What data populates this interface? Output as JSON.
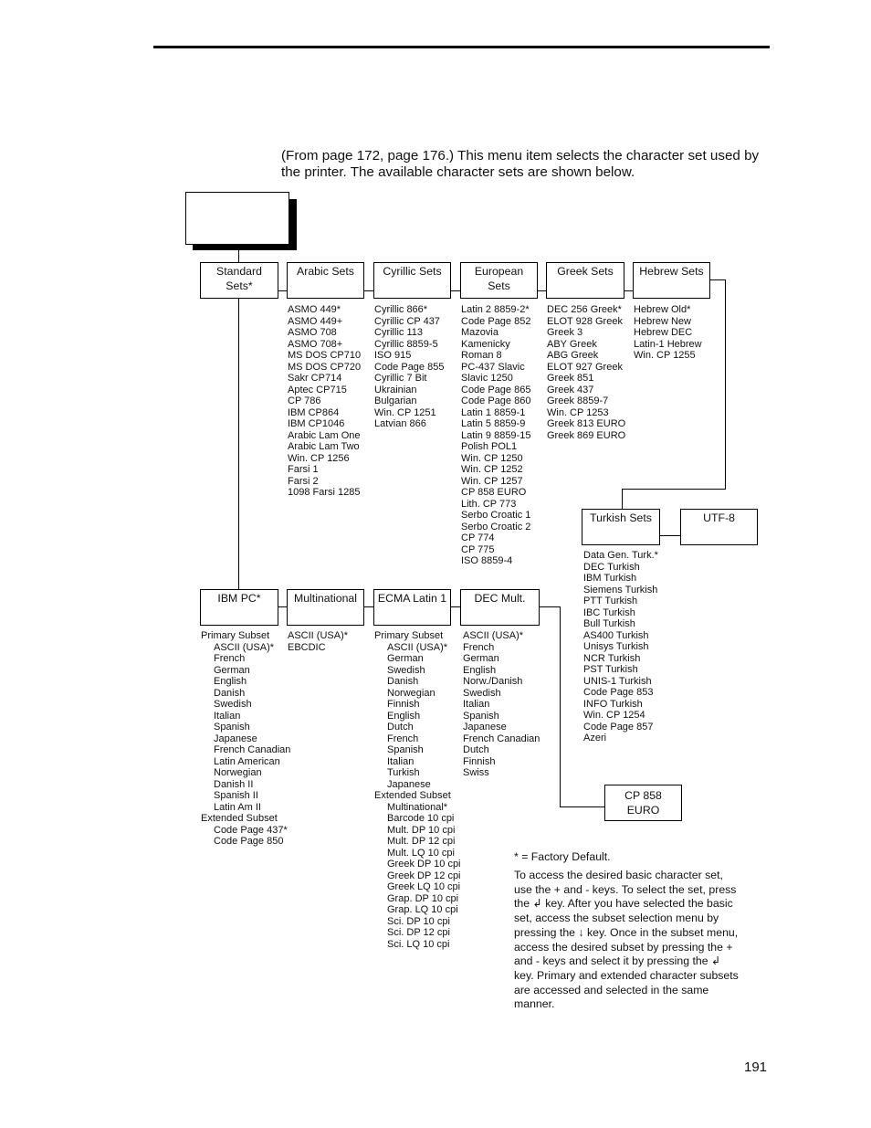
{
  "intro_text": "(From page 172, page 176.) This menu item selects the character set used by the printer. The available character sets are shown below.",
  "top_box_label": "",
  "row1": [
    {
      "label": "Standard Sets*",
      "items": []
    },
    {
      "label": "Arabic Sets",
      "items": [
        "ASMO 449*",
        "ASMO 449+",
        "ASMO 708",
        "ASMO 708+",
        "MS DOS CP710",
        "MS DOS CP720",
        "Sakr CP714",
        "Aptec CP715",
        "CP 786",
        "IBM CP864",
        "IBM CP1046",
        "Arabic Lam One",
        "Arabic Lam Two",
        "Win. CP 1256",
        "Farsi 1",
        "Farsi 2",
        "1098 Farsi 1285"
      ]
    },
    {
      "label": "Cyrillic Sets",
      "items": [
        "Cyrillic 866*",
        "Cyrillic CP 437",
        "Cyrillic 113",
        "Cyrillic 8859-5",
        "ISO 915",
        "Code Page 855",
        "Cyrillic 7 Bit",
        "Ukrainian",
        "Bulgarian",
        "Win. CP 1251",
        "Latvian 866"
      ]
    },
    {
      "label": "European Sets",
      "items": [
        "Latin 2 8859-2*",
        "Code Page 852",
        "Mazovia",
        "Kamenicky",
        "Roman 8",
        "PC-437 Slavic",
        "Slavic 1250",
        "Code Page 865",
        "Code Page 860",
        "Latin 1 8859-1",
        "Latin 5 8859-9",
        "Latin 9 8859-15",
        "Polish POL1",
        "Win. CP 1250",
        "Win. CP 1252",
        "Win. CP 1257",
        "CP 858 EURO",
        "Lith. CP 773",
        "Serbo Croatic 1",
        "Serbo Croatic 2",
        "CP 774",
        "CP 775",
        "ISO 8859-4"
      ]
    },
    {
      "label": "Greek Sets",
      "items": [
        "DEC 256 Greek*",
        "ELOT 928 Greek",
        "Greek 3",
        "ABY Greek",
        "ABG Greek",
        "ELOT 927 Greek",
        "Greek 851",
        "Greek 437",
        "Greek 8859-7",
        "Win. CP 1253",
        "Greek 813 EURO",
        "Greek 869 EURO"
      ]
    },
    {
      "label": "Hebrew Sets",
      "items": [
        "Hebrew Old*",
        "Hebrew New",
        "Hebrew DEC",
        "Latin-1 Hebrew",
        "Win. CP 1255"
      ]
    }
  ],
  "turkish": {
    "label": "Turkish Sets",
    "items": [
      "Data Gen. Turk.*",
      "DEC Turkish",
      "IBM Turkish",
      "Siemens Turkish",
      "PTT Turkish",
      "IBC Turkish",
      "Bull Turkish",
      "AS400 Turkish",
      "Unisys Turkish",
      "NCR Turkish",
      "PST Turkish",
      "UNIS-1 Turkish",
      "Code Page 853",
      "INFO Turkish",
      "Win. CP 1254",
      "Code Page 857",
      "Azeri"
    ]
  },
  "utf8": {
    "label": "UTF-8"
  },
  "row2": [
    {
      "label": "IBM PC*",
      "items": [
        {
          "text": "Primary Subset",
          "indent": false
        },
        {
          "text": "ASCII (USA)*",
          "indent": true
        },
        {
          "text": "French",
          "indent": true
        },
        {
          "text": "German",
          "indent": true
        },
        {
          "text": "English",
          "indent": true
        },
        {
          "text": "Danish",
          "indent": true
        },
        {
          "text": "Swedish",
          "indent": true
        },
        {
          "text": "Italian",
          "indent": true
        },
        {
          "text": "Spanish",
          "indent": true
        },
        {
          "text": "Japanese",
          "indent": true
        },
        {
          "text": "French Canadian",
          "indent": true
        },
        {
          "text": "Latin American",
          "indent": true
        },
        {
          "text": "Norwegian",
          "indent": true
        },
        {
          "text": "Danish II",
          "indent": true
        },
        {
          "text": "Spanish II",
          "indent": true
        },
        {
          "text": "Latin Am II",
          "indent": true
        },
        {
          "text": "Extended Subset",
          "indent": false
        },
        {
          "text": "Code Page 437*",
          "indent": true
        },
        {
          "text": "Code Page 850",
          "indent": true
        }
      ]
    },
    {
      "label": "Multinational",
      "items": [
        {
          "text": "ASCII (USA)*",
          "indent": false
        },
        {
          "text": "EBCDIC",
          "indent": false
        }
      ]
    },
    {
      "label": "ECMA Latin 1",
      "items": [
        {
          "text": "Primary Subset",
          "indent": false
        },
        {
          "text": "ASCII (USA)*",
          "indent": true
        },
        {
          "text": "German",
          "indent": true
        },
        {
          "text": "Swedish",
          "indent": true
        },
        {
          "text": "Danish",
          "indent": true
        },
        {
          "text": "Norwegian",
          "indent": true
        },
        {
          "text": "Finnish",
          "indent": true
        },
        {
          "text": "English",
          "indent": true
        },
        {
          "text": "Dutch",
          "indent": true
        },
        {
          "text": "French",
          "indent": true
        },
        {
          "text": "Spanish",
          "indent": true
        },
        {
          "text": "Italian",
          "indent": true
        },
        {
          "text": "Turkish",
          "indent": true
        },
        {
          "text": "Japanese",
          "indent": true
        },
        {
          "text": "Extended Subset",
          "indent": false
        },
        {
          "text": "Multinational*",
          "indent": true
        },
        {
          "text": "Barcode 10 cpi",
          "indent": true
        },
        {
          "text": "Mult. DP 10 cpi",
          "indent": true
        },
        {
          "text": "Mult. DP 12 cpi",
          "indent": true
        },
        {
          "text": "Mult. LQ 10 cpi",
          "indent": true
        },
        {
          "text": "Greek DP 10 cpi",
          "indent": true
        },
        {
          "text": "Greek DP 12 cpi",
          "indent": true
        },
        {
          "text": "Greek LQ 10 cpi",
          "indent": true
        },
        {
          "text": "Grap. DP 10 cpi",
          "indent": true
        },
        {
          "text": "Grap. LQ 10 cpi",
          "indent": true
        },
        {
          "text": "Sci. DP 10 cpi",
          "indent": true
        },
        {
          "text": "Sci. DP 12 cpi",
          "indent": true
        },
        {
          "text": "Sci. LQ 10 cpi",
          "indent": true
        }
      ]
    },
    {
      "label": "DEC Mult.",
      "items": [
        {
          "text": "ASCII (USA)*",
          "indent": false
        },
        {
          "text": "French",
          "indent": false
        },
        {
          "text": "German",
          "indent": false
        },
        {
          "text": "English",
          "indent": false
        },
        {
          "text": "Norw./Danish",
          "indent": false
        },
        {
          "text": "Swedish",
          "indent": false
        },
        {
          "text": "Italian",
          "indent": false
        },
        {
          "text": "Spanish",
          "indent": false
        },
        {
          "text": "Japanese",
          "indent": false
        },
        {
          "text": "French Canadian",
          "indent": false
        },
        {
          "text": "Dutch",
          "indent": false
        },
        {
          "text": "Finnish",
          "indent": false
        },
        {
          "text": "Swiss",
          "indent": false
        }
      ]
    }
  ],
  "cp858": {
    "label": "CP 858 EURO"
  },
  "factory_default_note": "* = Factory Default.",
  "instructions": "To access the desired basic character set, use the + and - keys. To select the set, press the ↲ key. After you have selected the basic set, access the subset selection menu by pressing the ↓ key. Once in the subset menu, access the desired subset by pressing the + and - keys and select it by pressing the ↲ key. Primary and extended character subsets are accessed and selected in the same manner.",
  "page_number": "191"
}
